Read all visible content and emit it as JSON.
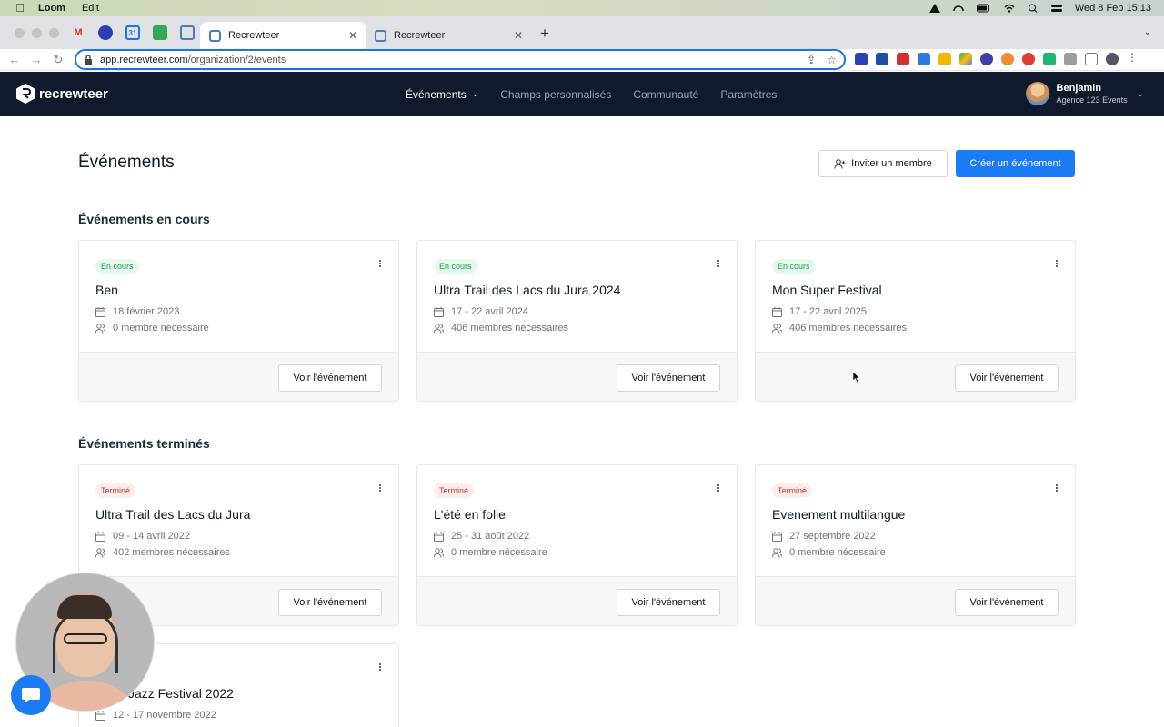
{
  "menubar": {
    "app_name": "Loom",
    "menu_edit": "Edit",
    "clock": "Wed 8 Feb  15:13"
  },
  "browser": {
    "tabs": [
      {
        "title": "Recrewteer",
        "active": true
      },
      {
        "title": "Recrewteer",
        "active": false
      }
    ],
    "url_host": "app.recrewteer.com",
    "url_path": "/organization/2/events"
  },
  "app": {
    "brand": "recrewteer",
    "nav": {
      "events": "Événements",
      "custom_fields": "Champs personnalisés",
      "community": "Communauté",
      "settings": "Paramètres"
    },
    "user": {
      "name": "Benjamin",
      "org": "Agence 123 Events"
    }
  },
  "page": {
    "title": "Événements",
    "invite_label": "Inviter un membre",
    "create_label": "Créer un événement",
    "ongoing_title": "Événements en cours",
    "finished_title": "Événements terminés",
    "view_label": "Voir l'événement"
  },
  "ongoing_events": [
    {
      "status": "En cours",
      "name": "Ben",
      "dates": "18 février 2023",
      "members": "0 membre nécessaire"
    },
    {
      "status": "En cours",
      "name": "Ultra Trail des Lacs du Jura 2024",
      "dates": "17 - 22 avril 2024",
      "members": "406 membres nécessaires"
    },
    {
      "status": "En cours",
      "name": "Mon Super Festival",
      "dates": "17 - 22 avril 2025",
      "members": "406 membres nécessaires"
    }
  ],
  "finished_events": [
    {
      "status": "Terminé",
      "name": "Ultra Trail des Lacs du Jura",
      "dates": "09 - 14 avril 2022",
      "members": "402 membres nécessaires"
    },
    {
      "status": "Terminé",
      "name": "L'été en folie",
      "dates": "25 - 31 août 2022",
      "members": "0 membre nécessaire"
    },
    {
      "status": "Terminé",
      "name": "Evenement multilangue",
      "dates": "27 septembre 2022",
      "members": "0 membre nécessaire"
    },
    {
      "name": "Jazz Festival 2022",
      "dates": "12 - 17 novembre 2022"
    }
  ],
  "colors": {
    "primary": "#1a7cf5",
    "header_bg": "#0f1b2d",
    "ongoing_badge": "#16a34a",
    "finished_badge": "#c0392b"
  }
}
